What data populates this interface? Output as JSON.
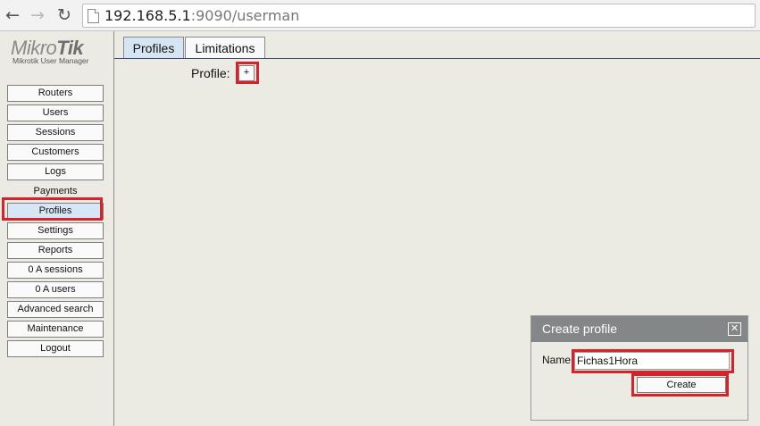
{
  "browser": {
    "back_icon": "arrow-left-icon",
    "forward_icon": "arrow-right-icon",
    "reload_icon": "reload-icon",
    "url_host": "192.168.5.1",
    "url_rest": ":9090/userman"
  },
  "sidebar": {
    "logo_light": "Mikro",
    "logo_bold": "Tik",
    "logo_sub": "Mikrotik User Manager",
    "items": [
      {
        "label": "Routers"
      },
      {
        "label": "Users"
      },
      {
        "label": "Sessions"
      },
      {
        "label": "Customers"
      },
      {
        "label": "Logs"
      },
      {
        "label": "Payments"
      },
      {
        "label": "Profiles"
      },
      {
        "label": "Settings"
      },
      {
        "label": "Reports"
      },
      {
        "label": "0 A sessions"
      },
      {
        "label": "0 A users"
      },
      {
        "label": "Advanced search"
      },
      {
        "label": "Maintenance"
      },
      {
        "label": "Logout"
      }
    ]
  },
  "main": {
    "tabs": [
      {
        "label": "Profiles"
      },
      {
        "label": "Limitations"
      }
    ],
    "profile_label": "Profile:",
    "add_label": "+"
  },
  "dialog": {
    "title": "Create profile",
    "close_label": "✕",
    "name_label": "Name",
    "name_value": "Fichas1Hora",
    "create_label": "Create"
  },
  "colors": {
    "highlight": "#d8222a",
    "dialog_header": "#838788",
    "active_tab": "#d6e5f3"
  }
}
